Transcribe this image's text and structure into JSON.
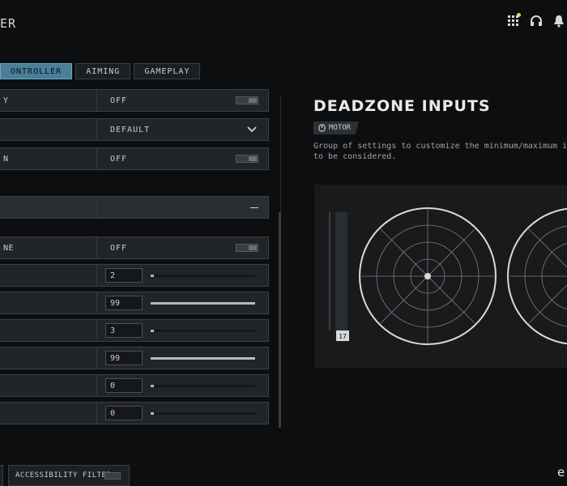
{
  "header": {
    "title": "ER"
  },
  "tabs": [
    {
      "label": "ONTROLLER",
      "active": true
    },
    {
      "label": "AIMING",
      "active": false
    },
    {
      "label": "GAMEPLAY",
      "active": false
    }
  ],
  "settings": [
    {
      "label": "Y",
      "value": "OFF",
      "control": "toggle"
    },
    {
      "label": "",
      "value": "DEFAULT",
      "control": "dropdown"
    },
    {
      "label": "N",
      "value": "OFF",
      "control": "toggle"
    },
    {
      "label": "",
      "value": "",
      "control": "section-collapse"
    },
    {
      "label": "NE",
      "value": "OFF",
      "control": "toggle"
    },
    {
      "label": "",
      "value": "2",
      "control": "slider",
      "level": 0.02
    },
    {
      "label": "",
      "value": "99",
      "control": "slider",
      "level": 0.99
    },
    {
      "label": "",
      "value": "3",
      "control": "slider",
      "level": 0.03
    },
    {
      "label": "",
      "value": "99",
      "control": "slider",
      "level": 0.99
    },
    {
      "label": "",
      "value": "0",
      "control": "slider",
      "level": 0.0
    },
    {
      "label": "",
      "value": "0",
      "control": "slider",
      "level": 0.0
    }
  ],
  "panel": {
    "title": "DEADZONE INPUTS",
    "badge": "MOTOR",
    "description_line1": "Group of settings to customize the minimum/maximum input re",
    "description_line2": "to be considered.",
    "meter_value": "17"
  },
  "footer": {
    "accessibility_label": "ACCESSIBILITY FILTER",
    "watermark": "e"
  },
  "colors": {
    "accent": "#4a7f9a",
    "background": "#0d0e0f",
    "row": "#222528"
  },
  "icons": [
    "grid-icon",
    "headset-icon",
    "bell-icon",
    "chevron-down-icon",
    "minus-icon",
    "gamepad-icon"
  ]
}
